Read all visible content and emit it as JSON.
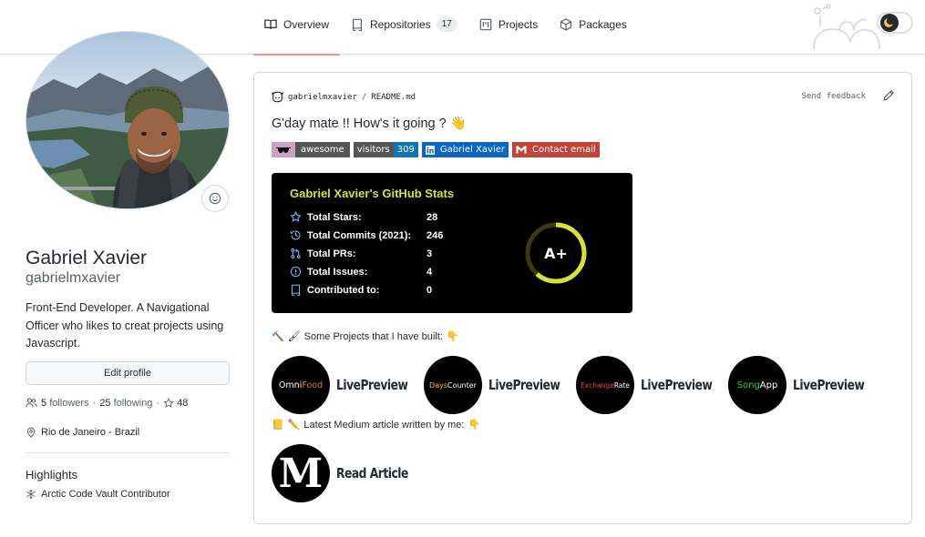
{
  "nav": {
    "tabs": [
      {
        "label": "Overview",
        "icon": "book-icon",
        "active": true
      },
      {
        "label": "Repositories",
        "icon": "repo-icon",
        "counter": "17"
      },
      {
        "label": "Projects",
        "icon": "project-icon"
      },
      {
        "label": "Packages",
        "icon": "package-icon"
      }
    ]
  },
  "profile": {
    "name": "Gabriel Xavier",
    "login": "gabrielmxavier",
    "bio": "Front-End Developer. A Navigational Officer who likes to creat projects using Javascript.",
    "edit_label": "Edit profile",
    "followers": "5",
    "followers_label": "followers",
    "following": "25",
    "following_label": "following",
    "stars": "48",
    "location": "Rio de Janeiro - Brazil",
    "highlights_title": "Highlights",
    "highlight_item": "Arctic Code Vault Contributor"
  },
  "readme": {
    "owner": "gabrielmxavier",
    "sep": "/",
    "file": "README.md",
    "send_feedback": "Send feedback",
    "greeting": "G'day mate !! How's it going ? 👋",
    "badges": [
      {
        "left": "awesome",
        "left_color": "#555",
        "icon_bg": "#c8a1c3"
      },
      {
        "left": "visitors",
        "right": "309",
        "left_color": "#555",
        "right_color": "#0e75b6"
      },
      {
        "left": "Gabriel Xavier",
        "bg": "#0a66c2"
      },
      {
        "left": "Contact email",
        "bg": "#c14438"
      }
    ],
    "stats": {
      "title": "Gabriel Xavier's GitHub Stats",
      "rows": [
        {
          "label": "Total Stars:",
          "value": "28",
          "icon": "star-icon"
        },
        {
          "label": "Total Commits (2021):",
          "value": "246",
          "icon": "history-icon"
        },
        {
          "label": "Total PRs:",
          "value": "3",
          "icon": "pull-request-icon"
        },
        {
          "label": "Total Issues:",
          "value": "4",
          "icon": "issue-icon"
        },
        {
          "label": "Contributed to:",
          "value": "0",
          "icon": "repo-icon"
        }
      ],
      "rank": "A+",
      "title_color": "#d8e03a"
    },
    "projects_line": "Some Projects that I have built:",
    "projects": [
      {
        "part1": "Omni",
        "part2": "Food",
        "c1": "#ffffff",
        "c2": "#e67e22",
        "live": "LivePreview"
      },
      {
        "part1": "Days",
        "part2": "Counter",
        "c1": "#f1c40f",
        "c2": "#ffffff",
        "live": "LivePreview"
      },
      {
        "part1": "Exchange",
        "part2": "Rate",
        "c1": "#e74c3c",
        "c2": "#ffffff",
        "live": "LivePreview"
      },
      {
        "part1": "Song",
        "part2": "App",
        "c1": "#2ecc40",
        "c2": "#ffffff",
        "live": "LivePreview"
      }
    ],
    "medium_line": "Latest Medium article written by me:",
    "medium_logo": "M",
    "medium_link": "Read Article"
  }
}
